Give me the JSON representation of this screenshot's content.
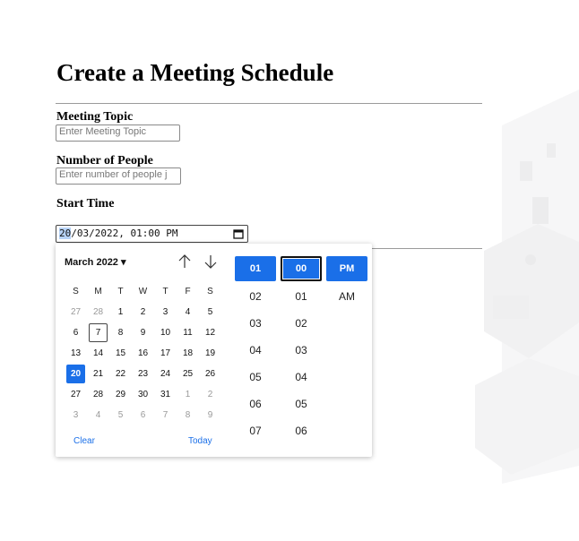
{
  "page": {
    "title": "Create a Meeting Schedule"
  },
  "form": {
    "topic_label": "Meeting Topic",
    "topic_placeholder": "Enter Meeting Topic",
    "people_label": "Number of People",
    "people_placeholder": "Enter number of people j",
    "start_label": "Start Time",
    "start_value": {
      "day": "20",
      "rest": "/03/2022, 01:00 PM"
    }
  },
  "picker": {
    "month_label": "March 2022 ▾",
    "weekdays": [
      "S",
      "M",
      "T",
      "W",
      "T",
      "F",
      "S"
    ],
    "weeks": [
      [
        "27",
        "28",
        "1",
        "2",
        "3",
        "4",
        "5"
      ],
      [
        "6",
        "7",
        "8",
        "9",
        "10",
        "11",
        "12"
      ],
      [
        "13",
        "14",
        "15",
        "16",
        "17",
        "18",
        "19"
      ],
      [
        "20",
        "21",
        "22",
        "23",
        "24",
        "25",
        "26"
      ],
      [
        "27",
        "28",
        "29",
        "30",
        "31",
        "1",
        "2"
      ],
      [
        "3",
        "4",
        "5",
        "6",
        "7",
        "8",
        "9"
      ]
    ],
    "selected_day": "20",
    "today_day": "7",
    "clear_label": "Clear",
    "today_label": "Today",
    "hours": [
      "01",
      "02",
      "03",
      "04",
      "05",
      "06",
      "07"
    ],
    "minutes": [
      "00",
      "01",
      "02",
      "03",
      "04",
      "05",
      "06"
    ],
    "ampm": [
      "PM",
      "AM"
    ],
    "selected_hour": "01",
    "selected_minute": "00",
    "selected_ampm": "PM"
  },
  "colors": {
    "accent": "#1a6fe8",
    "selection_highlight": "#b7d3f7"
  }
}
